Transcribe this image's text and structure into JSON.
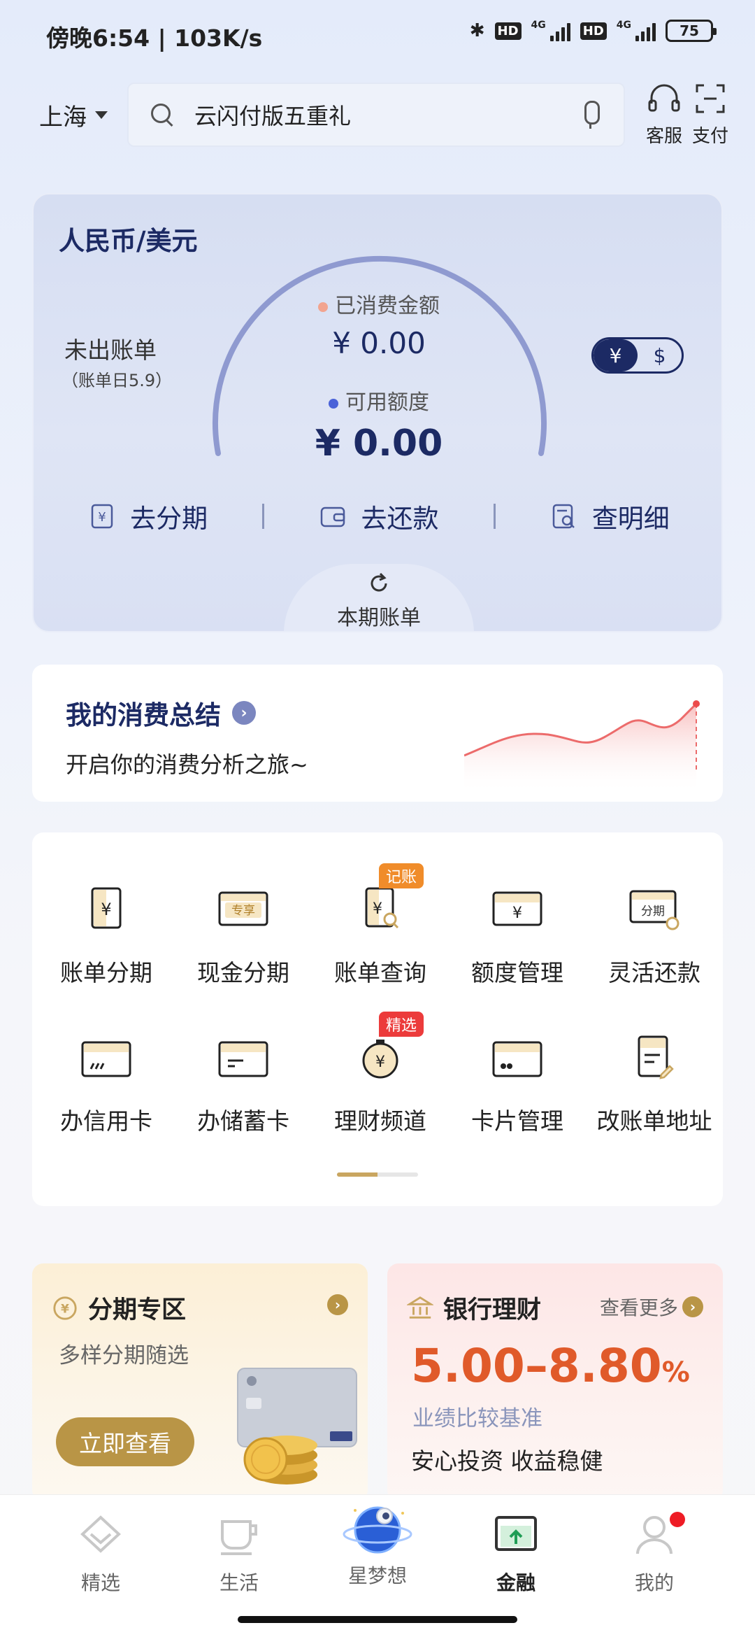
{
  "status_bar": {
    "time": "傍晚6:54 | 103K/s",
    "hd1": "HD",
    "hd2": "HD",
    "net1": "4G",
    "net2": "4G",
    "battery": "75"
  },
  "header": {
    "city": "上海",
    "search_text": "云闪付版五重礼",
    "service_label": "客服",
    "pay_label": "支付"
  },
  "bill_card": {
    "title": "人民币/美元",
    "status": "未出账单",
    "bill_date": "（账单日5.9）",
    "spent_label": "已消费金额",
    "spent_value": "¥ 0.00",
    "available_label": "可用额度",
    "available_value": "¥ 0.00",
    "currency_cny": "¥",
    "currency_usd": "$",
    "actions": [
      "去分期",
      "去还款",
      "查明细"
    ],
    "current_bill_label": "本期账单",
    "colors": {
      "spent_dot": "#f2a48f",
      "available_dot": "#4a62d8",
      "gauge": "#8f9ad0"
    }
  },
  "summary": {
    "title": "我的消费总结",
    "subtitle": "开启你的消费分析之旅~"
  },
  "services": {
    "row1": [
      {
        "label": "账单分期",
        "icon": "bill-installment-icon"
      },
      {
        "label": "现金分期",
        "icon": "cash-installment-icon",
        "inner": "专享"
      },
      {
        "label": "账单查询",
        "icon": "bill-query-icon",
        "tag": "记账"
      },
      {
        "label": "额度管理",
        "icon": "credit-limit-icon"
      },
      {
        "label": "灵活还款",
        "icon": "flexible-repay-icon",
        "inner": "分期"
      }
    ],
    "row2": [
      {
        "label": "办信用卡",
        "icon": "apply-credit-card-icon"
      },
      {
        "label": "办储蓄卡",
        "icon": "apply-debit-card-icon"
      },
      {
        "label": "理财频道",
        "icon": "wealth-channel-icon",
        "tag": "精选"
      },
      {
        "label": "卡片管理",
        "icon": "card-management-icon"
      },
      {
        "label": "改账单地址",
        "icon": "change-address-icon"
      }
    ]
  },
  "promo_installment": {
    "title": "分期专区",
    "subtitle": "多样分期随选",
    "button": "立即查看"
  },
  "promo_wealth": {
    "title": "银行理财",
    "more": "查看更多",
    "rate": "5.00–8.80",
    "rate_unit": "%",
    "rate_caption": "业绩比较基准",
    "slogan": "安心投资 收益稳健"
  },
  "bottom_nav": {
    "items": [
      "精选",
      "生活",
      "星梦想",
      "金融",
      "我的"
    ],
    "active": "金融"
  }
}
